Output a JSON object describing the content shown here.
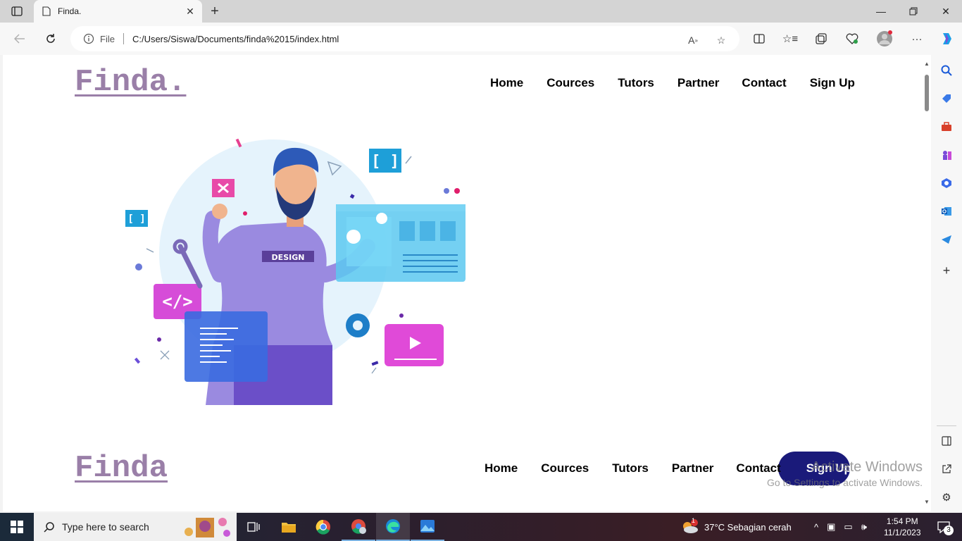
{
  "browser": {
    "tab_title": "Finda.",
    "address": {
      "info_label": "File",
      "url": "C:/Users/Siswa/Documents/finda%2015/index.html"
    }
  },
  "page": {
    "header": {
      "logo": "Finda.",
      "nav": [
        "Home",
        "Cources",
        "Tutors",
        "Partner",
        "Contact",
        "Sign Up"
      ]
    },
    "hero": {
      "shirt_text": "DESIGN"
    },
    "second_header": {
      "logo": "Finda",
      "nav": [
        "Home",
        "Cources",
        "Tutors",
        "Partner",
        "Contact",
        "Sign Up"
      ]
    }
  },
  "watermark": {
    "title": "Activate Windows",
    "subtitle": "Go to Settings to activate Windows."
  },
  "taskbar": {
    "search_placeholder": "Type here to search",
    "weather": "37°C  Sebagian cerah",
    "time": "1:54 PM",
    "date": "11/1/2023",
    "notification_count": "3",
    "weather_badge": "1"
  },
  "colors": {
    "logo": "#9a7fa8",
    "signup_pill": "#1a1a7a"
  }
}
